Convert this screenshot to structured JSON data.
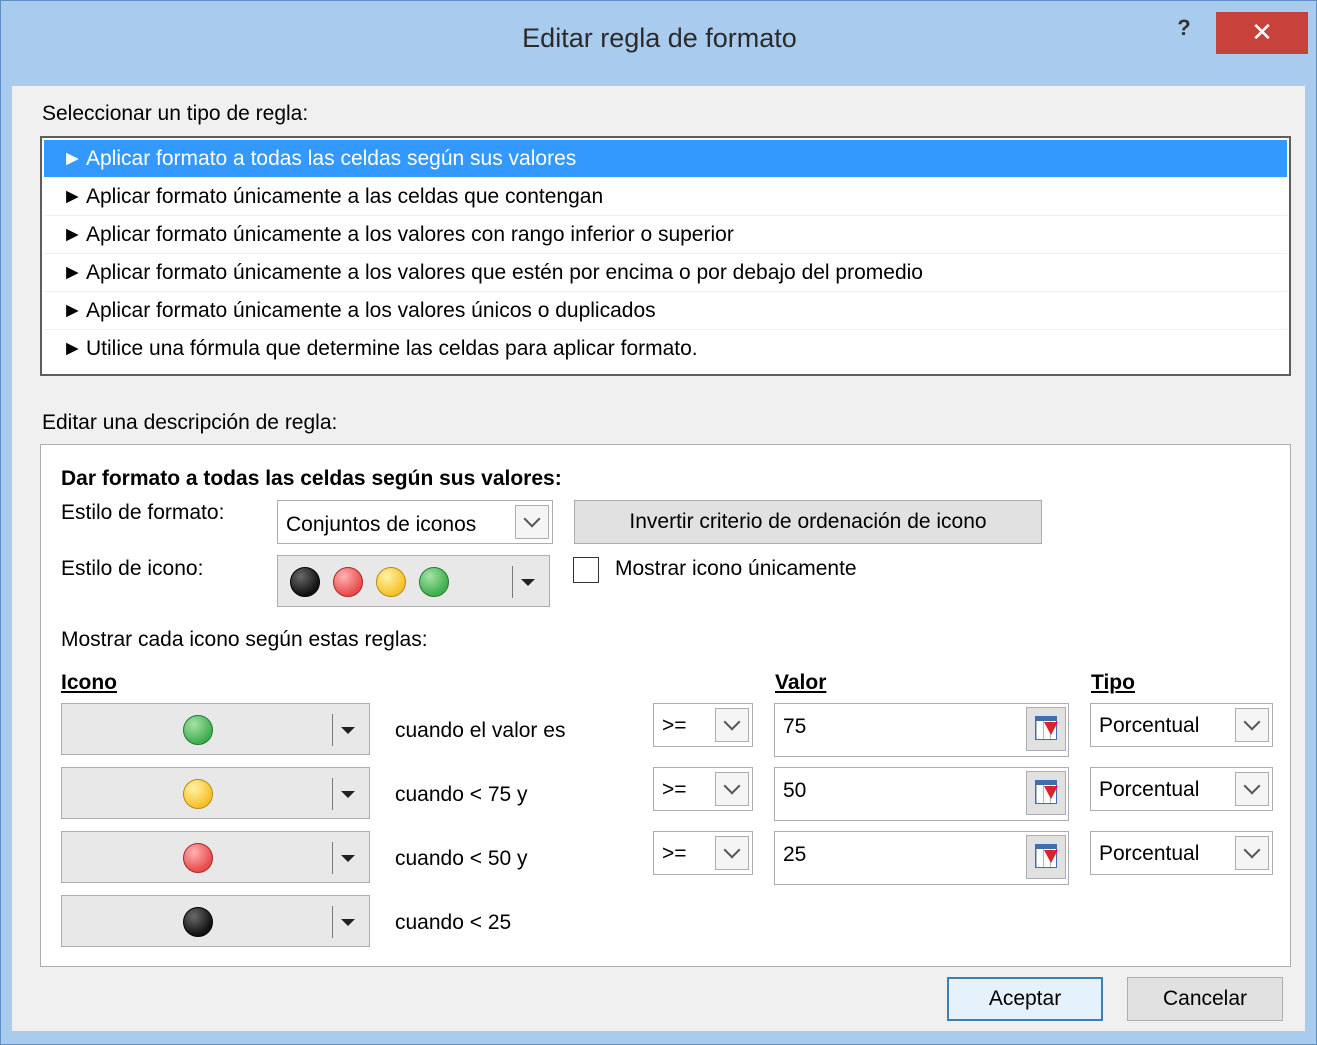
{
  "window": {
    "title": "Editar regla de formato",
    "help_label": "?",
    "close_label": "✕"
  },
  "rule_type": {
    "label": "Seleccionar un tipo de regla:",
    "items": [
      "Aplicar formato a todas las celdas según sus valores",
      "Aplicar formato únicamente a las celdas que contengan",
      "Aplicar formato únicamente a los valores con rango inferior o superior",
      "Aplicar formato únicamente a los valores que estén por encima o por debajo del promedio",
      "Aplicar formato únicamente a los valores únicos o duplicados",
      "Utilice una fórmula que determine las celdas para aplicar formato."
    ],
    "selected_index": 0,
    "bullet": "►"
  },
  "description": {
    "label": "Editar una descripción de regla:",
    "heading": "Dar formato a todas las celdas según sus valores:",
    "format_style_label": "Estilo de formato:",
    "format_style_value": "Conjuntos de iconos",
    "reverse_button": "Invertir criterio de ordenación de icono",
    "icon_style_label": "Estilo de icono:",
    "icon_style_icons": [
      "black-circle-icon",
      "red-circle-icon",
      "yellow-circle-icon",
      "green-circle-icon"
    ],
    "show_icon_only_label": "Mostrar icono únicamente",
    "show_icon_only_checked": false,
    "rules_caption": "Mostrar cada icono según estas reglas:",
    "col_icon": "Icono",
    "col_value": "Valor",
    "col_type": "Tipo",
    "rows": [
      {
        "icon": "green-circle-icon",
        "condition": "cuando el valor es",
        "operator": ">=",
        "value": "75",
        "type": "Porcentual"
      },
      {
        "icon": "yellow-circle-icon",
        "condition": "cuando < 75 y",
        "operator": ">=",
        "value": "50",
        "type": "Porcentual"
      },
      {
        "icon": "red-circle-icon",
        "condition": "cuando < 50 y",
        "operator": ">=",
        "value": "25",
        "type": "Porcentual"
      },
      {
        "icon": "black-circle-icon",
        "condition": "cuando < 25"
      }
    ]
  },
  "buttons": {
    "ok": "Aceptar",
    "cancel": "Cancelar"
  },
  "colors": {
    "selection": "#3399ff",
    "title_bar": "#a9cbee",
    "close_button": "#c7423a"
  }
}
